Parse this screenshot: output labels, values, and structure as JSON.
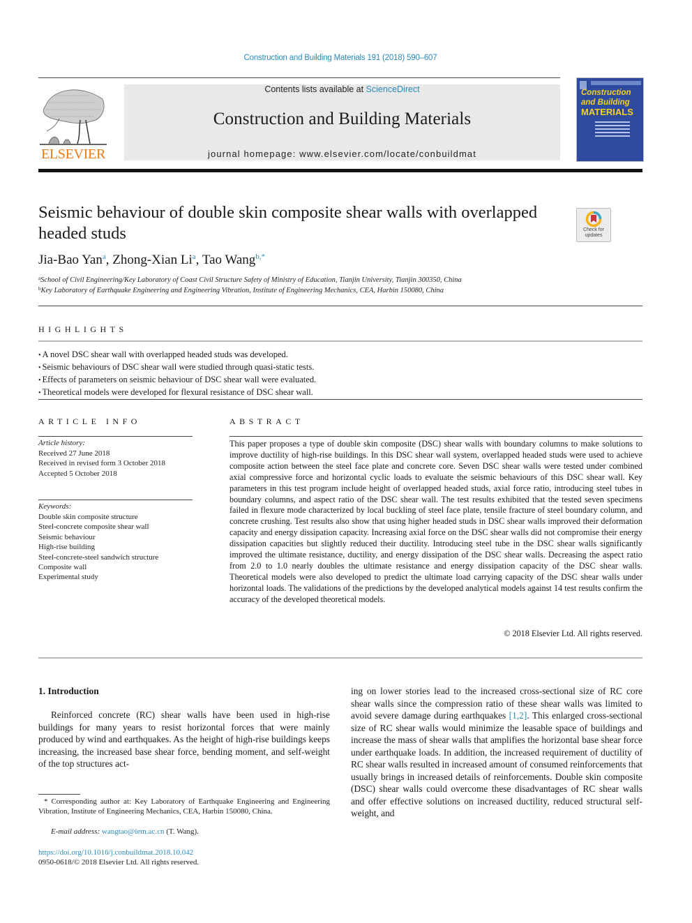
{
  "header": {
    "journal_reference": "Construction and Building Materials 191 (2018) 590–607",
    "publisher": "ELSEVIER",
    "contents_prefix": "Contents lists available at ",
    "contents_link": "ScienceDirect",
    "journal_name": "Construction and Building Materials",
    "homepage": "journal homepage: www.elsevier.com/locate/conbuildmat",
    "cover": {
      "line1": "Construction",
      "line2": "and Building",
      "line3": "MATERIALS"
    },
    "colors": {
      "link": "#2a8ab8",
      "elsevier_orange": "#f07a12",
      "cover_blue": "#2e4a9e",
      "cover_yellow": "#f4d21f"
    }
  },
  "article": {
    "title": "Seismic behaviour of double skin composite shear walls with overlapped headed studs",
    "check_updates": {
      "line1": "Check for",
      "line2": "updates"
    },
    "authors": [
      {
        "name": "Jia-Bao Yan",
        "sup": "a"
      },
      {
        "name": "Zhong-Xian Li",
        "sup": "a"
      },
      {
        "name": "Tao Wang",
        "sup": "b,*"
      }
    ],
    "affiliations": [
      {
        "mark": "a",
        "text": "School of Civil Engineering/Key Laboratory of Coast Civil Structure Safety of Ministry of Education, Tianjin University, Tianjin 300350, China"
      },
      {
        "mark": "b",
        "text": "Key Laboratory of Earthquake Engineering and Engineering Vibration, Institute of Engineering Mechanics, CEA, Harbin 150080, China"
      }
    ]
  },
  "highlights": {
    "heading": "HIGHLIGHTS",
    "items": [
      "A novel DSC shear wall with overlapped headed studs was developed.",
      "Seismic behaviours of DSC shear wall were studied through quasi-static tests.",
      "Effects of parameters on seismic behaviour of DSC shear wall were evaluated.",
      "Theoretical models were developed for flexural resistance of DSC shear wall."
    ]
  },
  "article_info": {
    "heading": "ARTICLE INFO",
    "history_label": "Article history:",
    "history": [
      "Received 27 June 2018",
      "Received in revised form 3 October 2018",
      "Accepted 5 October 2018"
    ],
    "keywords_label": "Keywords:",
    "keywords": [
      "Double skin composite structure",
      "Steel-concrete composite shear wall",
      "Seismic behaviour",
      "High-rise building",
      "Steel-concrete-steel sandwich structure",
      "Composite wall",
      "Experimental study"
    ]
  },
  "abstract": {
    "heading": "ABSTRACT",
    "text": "This paper proposes a type of double skin composite (DSC) shear walls with boundary columns to make solutions to improve ductility of high-rise buildings. In this DSC shear wall system, overlapped headed studs were used to achieve composite action between the steel face plate and concrete core. Seven DSC shear walls were tested under combined axial compressive force and horizontal cyclic loads to eval­uate the seismic behaviours of this DSC shear wall. Key parameters in this test program include height of overlapped headed studs, axial force ratio, introducing steel tubes in boundary columns, and aspect ratio of the DSC shear wall. The test results exhibited that the tested seven specimens failed in flexure mode characterized by local buckling of steel face plate, tensile fracture of steel boundary column, and concrete crushing. Test results also show that using higher headed studs in DSC shear walls improved their defor­mation capacity and energy dissipation capacity. Increasing axial force on the DSC shear walls did not compromise their energy dissipation capacities but slightly reduced their ductility. Introducing steel tube in the DSC shear walls significantly improved the ultimate resistance, ductility, and energy dissipation of the DSC shear walls. Decreasing the aspect ratio from 2.0 to 1.0 nearly doubles the ultimate resistance and energy dissipation capacity of the DSC shear walls. Theoretical models were also developed to predict the ultimate load carrying capacity of the DSC shear walls under horizontal loads. The validations of the predictions by the developed analytical models against 14 test results confirm the accuracy of the devel­oped theoretical models.",
    "copyright": "© 2018 Elsevier Ltd. All rights reserved."
  },
  "introduction": {
    "heading": "1. Introduction",
    "left_text": "Reinforced concrete (RC) shear walls have been used in high-rise buildings for many years to resist horizontal forces that were mainly produced by wind and earthquakes. As the height of high-rise buildings keeps increasing, the increased base shear force, bending moment, and self-weight of the top structures act-",
    "right_text_before_ref": "ing on lower stories lead to the increased cross-sectional size of RC core shear walls since the compression ratio of these shear walls was limited to avoid severe damage during earthquakes ",
    "citation": "[1,2]",
    "right_text_after_ref": ". This enlarged cross-sectional size of RC shear walls would minimize the leasable space of buildings and increase the mass of shear walls that amplifies the horizontal base shear force under earthquake loads. In addition, the increased requirement of ductil­ity of RC shear walls resulted in increased amount of consumed reinforcements that usually brings in increased details of reinforce­ments. Double skin composite (DSC) shear walls could overcome these disadvantages of RC shear walls and offer effective solutions on increased ductility, reduced structural self-weight, and"
  },
  "footer": {
    "corresponding": "* Corresponding author at: Key Laboratory of Earthquake Engineering and Engineering Vibration, Institute of Engineering Mechanics, CEA, Harbin 150080, China.",
    "email_label": "E-mail address:",
    "email": "wangtao@iem.ac.cn",
    "email_suffix": " (T. Wang).",
    "doi": "https://doi.org/10.1016/j.conbuildmat.2018.10.042",
    "issn": "0950-0618/© 2018 Elsevier Ltd. All rights reserved."
  }
}
